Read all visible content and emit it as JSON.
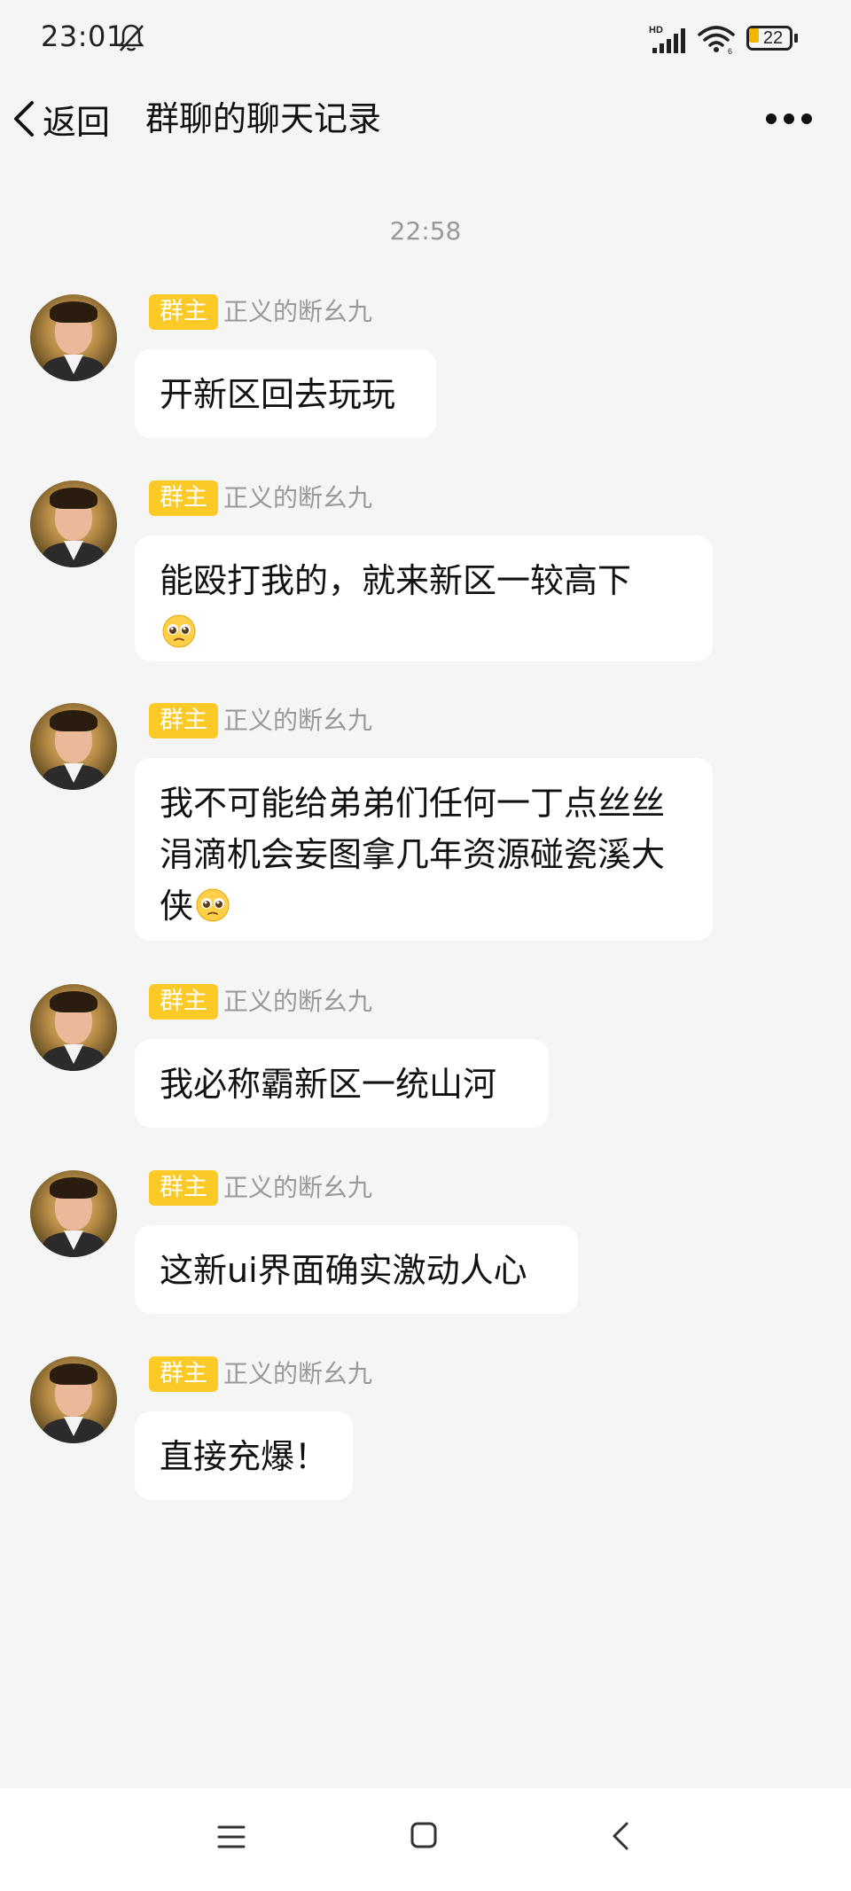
{
  "status_bar": {
    "time": "23:01",
    "network": "HD",
    "signal_sub": "6",
    "battery_level": "22",
    "icons": [
      "bell-off-icon",
      "signal-icon",
      "wifi-icon",
      "battery-icon"
    ]
  },
  "header": {
    "back_label": "返回",
    "title": "群聊的聊天记录",
    "icons": [
      "chevron-left-icon",
      "more-dots-icon"
    ]
  },
  "timestamp": "22:58",
  "owner_badge": "群主",
  "sender_name": "正义的断幺九",
  "messages": [
    {
      "text": "开新区回去玩玩",
      "emoji": ""
    },
    {
      "text": "能殴打我的，就来新区一较高下",
      "emoji": "pleading-face-emoji"
    },
    {
      "text": "我不可能给弟弟们任何一丁点丝丝涓滴机会妄图拿几年资源碰瓷溪大侠",
      "emoji": "pleading-face-emoji"
    },
    {
      "text": "我必称霸新区一统山河",
      "emoji": ""
    },
    {
      "text": "这新ui界面确实激动人心",
      "emoji": ""
    },
    {
      "text": "直接充爆！",
      "emoji": ""
    }
  ],
  "colors": {
    "background": "#f5f5f5",
    "bubble": "#ffffff",
    "badge": "#fcca26",
    "name": "#9a9a9a"
  },
  "nav_bar": {
    "icons": [
      "menu-icon",
      "home-square-icon",
      "back-triangle-icon"
    ]
  }
}
